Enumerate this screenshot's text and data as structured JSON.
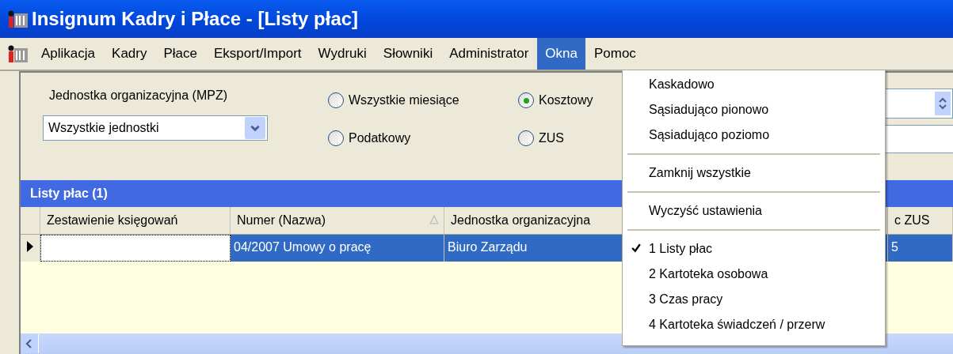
{
  "window": {
    "title": "Insignum Kadry i Płace - [Listy płac]"
  },
  "menu_bar": [
    {
      "label": "Aplikacja",
      "selected": false
    },
    {
      "label": "Kadry",
      "selected": false
    },
    {
      "label": "Płace",
      "selected": false
    },
    {
      "label": "Eksport/Import",
      "selected": false
    },
    {
      "label": "Wydruki",
      "selected": false
    },
    {
      "label": "Słowniki",
      "selected": false
    },
    {
      "label": "Administrator",
      "selected": false
    },
    {
      "label": "Okna",
      "selected": true
    },
    {
      "label": "Pomoc",
      "selected": false
    }
  ],
  "filter": {
    "unit_label": "Jednostka organizacyjna (MPZ)",
    "unit_value": "Wszystkie jednostki",
    "radios": [
      {
        "label": "Wszystkie miesiące",
        "selected": false
      },
      {
        "label": "Kosztowy",
        "selected": true
      },
      {
        "label": "Podatkowy",
        "selected": false
      },
      {
        "label": "ZUS",
        "selected": false
      }
    ]
  },
  "grid": {
    "title": "Listy płac (1)",
    "columns": [
      {
        "label": "Zestawienie księgowań",
        "sorted": false
      },
      {
        "label": "Numer (Nazwa)",
        "sorted": true
      },
      {
        "label": "Jednostka organizacyjna",
        "sorted": false
      },
      {
        "label": "c ZUS",
        "sorted": false
      }
    ],
    "rows": [
      {
        "selected": true,
        "cells": [
          "",
          "04/2007 Umowy o pracę",
          "Biuro Zarządu",
          "5"
        ]
      }
    ]
  },
  "okna_menu": [
    {
      "kind": "item",
      "label": "Kaskadowo",
      "checked": false
    },
    {
      "kind": "item",
      "label": "Sąsiadująco pionowo",
      "checked": false
    },
    {
      "kind": "item",
      "label": "Sąsiadująco poziomo",
      "checked": false
    },
    {
      "kind": "separator"
    },
    {
      "kind": "item",
      "label": "Zamknij wszystkie",
      "checked": false
    },
    {
      "kind": "separator"
    },
    {
      "kind": "item",
      "label": "Wyczyść ustawienia",
      "checked": false
    },
    {
      "kind": "separator"
    },
    {
      "kind": "item",
      "label": "1 Listy płac",
      "checked": true
    },
    {
      "kind": "item",
      "label": "2 Kartoteka osobowa",
      "checked": false
    },
    {
      "kind": "item",
      "label": "3 Czas pracy",
      "checked": false
    },
    {
      "kind": "item",
      "label": "4 Kartoteka świadczeń / przerw",
      "checked": false
    }
  ]
}
